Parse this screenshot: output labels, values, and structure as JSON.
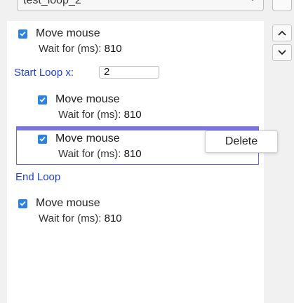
{
  "top_dropdown": {
    "value": "test_loop_2"
  },
  "items": [
    {
      "title": "Move mouse",
      "wait_label": "Wait for (ms):",
      "wait_value": "810"
    },
    {
      "title": "Move mouse",
      "wait_label": "Wait for (ms):",
      "wait_value": "810"
    },
    {
      "title": "Move mouse",
      "wait_label": "Wait for (ms):",
      "wait_value": "810"
    },
    {
      "title": "Move mouse",
      "wait_label": "Wait for (ms):",
      "wait_value": "810"
    }
  ],
  "loop": {
    "start_label": "Start Loop x:",
    "count": "2",
    "end_label": "End Loop"
  },
  "context_menu": {
    "delete_label": "Delete"
  },
  "colors": {
    "checkbox": "#2d82e0",
    "loop_text": "#1d3fd6",
    "selection_border": "#6a67d8"
  },
  "icons": {
    "scroll_up": "chevron-up-icon",
    "scroll_down": "chevron-down-icon"
  }
}
